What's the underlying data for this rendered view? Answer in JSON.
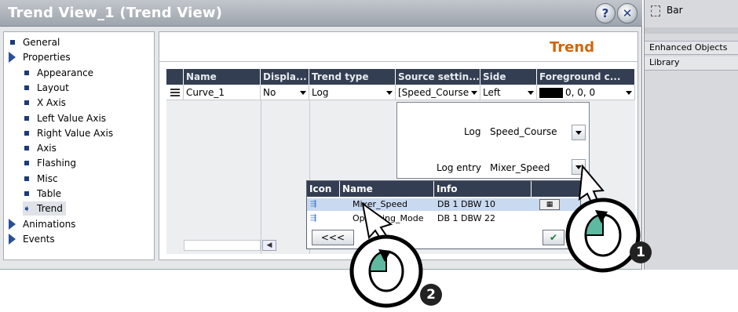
{
  "window": {
    "title": "Trend View_1 (Trend View)",
    "help_glyph": "?",
    "close_glyph": "✕"
  },
  "tree": {
    "items": [
      {
        "label": "General",
        "kind": "leaf",
        "level": 0
      },
      {
        "label": "Properties",
        "kind": "expander",
        "level": 0
      },
      {
        "label": "Appearance",
        "kind": "leaf",
        "level": 1
      },
      {
        "label": "Layout",
        "kind": "leaf",
        "level": 1
      },
      {
        "label": "X Axis",
        "kind": "leaf",
        "level": 1
      },
      {
        "label": "Left Value Axis",
        "kind": "leaf",
        "level": 1
      },
      {
        "label": "Right Value Axis",
        "kind": "leaf",
        "level": 1
      },
      {
        "label": "Axis",
        "kind": "leaf",
        "level": 1
      },
      {
        "label": "Flashing",
        "kind": "leaf",
        "level": 1
      },
      {
        "label": "Misc",
        "kind": "leaf",
        "level": 1
      },
      {
        "label": "Table",
        "kind": "leaf",
        "level": 1
      },
      {
        "label": "Trend",
        "kind": "selected",
        "level": 1
      },
      {
        "label": "Animations",
        "kind": "expander",
        "level": 0
      },
      {
        "label": "Events",
        "kind": "expander",
        "level": 0
      }
    ]
  },
  "section_title": "Trend",
  "table": {
    "columns": [
      "Name",
      "Displa...",
      "Trend type",
      "Source settin...",
      "Side",
      "Foreground c..."
    ],
    "row": {
      "name": "Curve_1",
      "display": "No",
      "trend_type": "Log",
      "source": "[Speed_Course",
      "side": "Left",
      "foreground": "0, 0, 0"
    }
  },
  "source_popup": {
    "log_label": "Log",
    "log_value": "Speed_Course",
    "entry_label": "Log entry",
    "entry_value": "Mixer_Speed"
  },
  "entry_list": {
    "columns": [
      "Icon",
      "Name",
      "Info"
    ],
    "rows": [
      {
        "icon": "tag-icon",
        "name": "Mixer_Speed",
        "info": "DB 1 DBW 10"
      },
      {
        "icon": "tag-icon",
        "name": "Operating_Mode",
        "info": "DB 1 DBW 22"
      }
    ],
    "back_button": "<<<",
    "ok_glyph": "✔"
  },
  "right_panel": {
    "item": "Bar",
    "sections": [
      "Enhanced Objects",
      "Library"
    ]
  },
  "callouts": [
    "1",
    "2"
  ],
  "colors": {
    "accent": "#d0660e",
    "header": "#333e52",
    "tree_icon": "#1e3a7a",
    "callout": "#5fb8a0"
  }
}
